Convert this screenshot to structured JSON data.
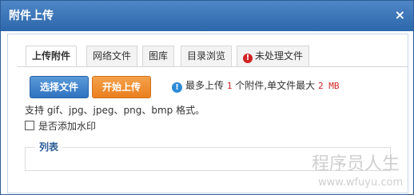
{
  "dialog": {
    "title": "附件上传",
    "close_symbol": "×"
  },
  "tabs": [
    {
      "label": "上传附件",
      "active": true
    },
    {
      "label": "网络文件",
      "active": false
    },
    {
      "label": "图库",
      "active": false
    },
    {
      "label": "目录浏览",
      "active": false
    },
    {
      "label": "未处理文件",
      "active": false,
      "icon": "warning-icon"
    }
  ],
  "buttons": {
    "select_label": "选择文件",
    "start_label": "开始上传"
  },
  "info": {
    "prefix": "最多上传",
    "max_files": "1",
    "middle": "个附件,单文件最大",
    "max_size": "2 MB"
  },
  "formats_text": "支持 gif、jpg、jpeg、png、bmp 格式。",
  "watermark_label": "是否添加水印",
  "list_legend": "列表",
  "site": {
    "name": "程序员人生",
    "url": "www.wfuyu.com"
  },
  "colors": {
    "titlebar": "#2c67ab",
    "select_button": "#2f72c0",
    "start_button": "#ea7f1e",
    "alert_red": "#d12222",
    "info_blue": "#2b8ad8"
  }
}
